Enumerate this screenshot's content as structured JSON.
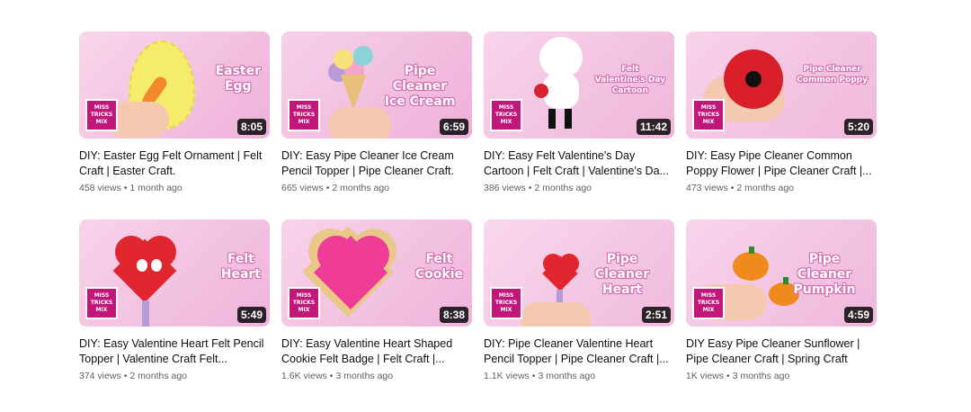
{
  "videos": [
    {
      "title": "DIY: Easter Egg Felt Ornament | Felt Craft | Easter Craft.",
      "views": "458 views",
      "age": "1 month ago",
      "duration": "8:05",
      "thumb_text": "Easter\nEgg",
      "bg": "#f6c6e2"
    },
    {
      "title": "DIY: Easy Pipe Cleaner Ice Cream Pencil Topper | Pipe Cleaner Craft.",
      "views": "665 views",
      "age": "2 months ago",
      "duration": "6:59",
      "thumb_text": "Pipe Cleaner\nIce Cream",
      "bg": "#f3bfe0"
    },
    {
      "title": "DIY: Easy Felt Valentine's Day Cartoon | Felt Craft | Valentine's Da...",
      "views": "386 views",
      "age": "2 months ago",
      "duration": "11:42",
      "thumb_text": "Felt\nValentine's Day\nCartoon",
      "bg": "#f5cbe6"
    },
    {
      "title": "DIY: Easy Pipe Cleaner Common Poppy Flower | Pipe Cleaner Craft |...",
      "views": "473 views",
      "age": "2 months ago",
      "duration": "5:20",
      "thumb_text": "Pipe Cleaner\nCommon Poppy",
      "bg": "#f4c3e2"
    },
    {
      "title": "DIY: Easy Valentine Heart Felt Pencil Topper | Valentine Craft Felt...",
      "views": "374 views",
      "age": "2 months ago",
      "duration": "5:49",
      "thumb_text": "Felt\nHeart",
      "bg": "#f3c1e1"
    },
    {
      "title": "DIY: Easy Valentine Heart Shaped Cookie Felt Badge | Felt Craft |...",
      "views": "1.6K views",
      "age": "3 months ago",
      "duration": "8:38",
      "thumb_text": "Felt\nCookie",
      "bg": "#f4c6e3"
    },
    {
      "title": "DIY: Pipe Cleaner Valentine Heart Pencil Topper | Pipe Cleaner Craft |...",
      "views": "1.1K views",
      "age": "3 months ago",
      "duration": "2:51",
      "thumb_text": "Pipe Cleaner\nHeart",
      "bg": "#f6cde7"
    },
    {
      "title": "DIY Easy Pipe Cleaner Sunflower | Pipe Cleaner Craft | Spring Craft",
      "views": "1K views",
      "age": "3 months ago",
      "duration": "4:59",
      "thumb_text": "Pipe Cleaner\nPumpkin",
      "bg": "#f5c8e4"
    }
  ],
  "channel_logo_text": "MISS\nTRICKS\nMIX",
  "meta_separator": "•"
}
